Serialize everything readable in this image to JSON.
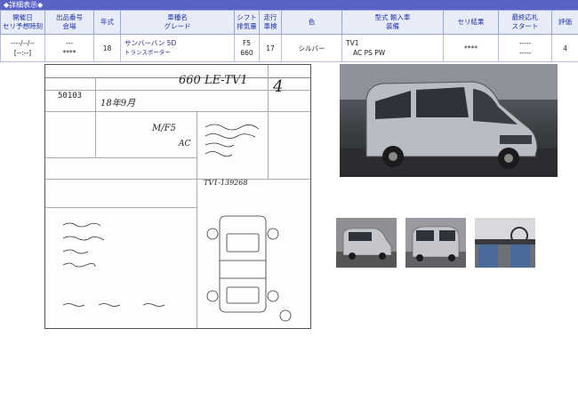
{
  "title": "◆詳細表示◆",
  "headers": {
    "date": "開催日\nセリ予想時刻",
    "lot": "出品番号\n会場",
    "year": "年式",
    "name": "車種名\nグレード",
    "shift": "シフト\n排気量",
    "mileage": "走行\n車検",
    "color": "色",
    "model": "型式 輸入車\n装備",
    "auction": "セリ結果",
    "bid": "最終応札\nスタート",
    "eval": "評価"
  },
  "row": {
    "date1": "----/--/--",
    "date2": "[--:--]",
    "lot1": "---",
    "lot2": "****",
    "year": "18",
    "name1": "サンバーバン 5D",
    "name2": "トランスポーター",
    "shift": "F5",
    "cc": "660",
    "mileage": "17",
    "color": "シルバー",
    "model": "TV1",
    "equip": "AC PS PW",
    "auction": "****",
    "bid1": "-----",
    "bid2": "-----",
    "eval": "4"
  },
  "sheet": {
    "lotno": "50103",
    "grade": "660 LE-TV1",
    "year": "18年9月",
    "score": "4",
    "spec": "M/F5",
    "ac": "AC",
    "chassis": "TV1-139268"
  }
}
